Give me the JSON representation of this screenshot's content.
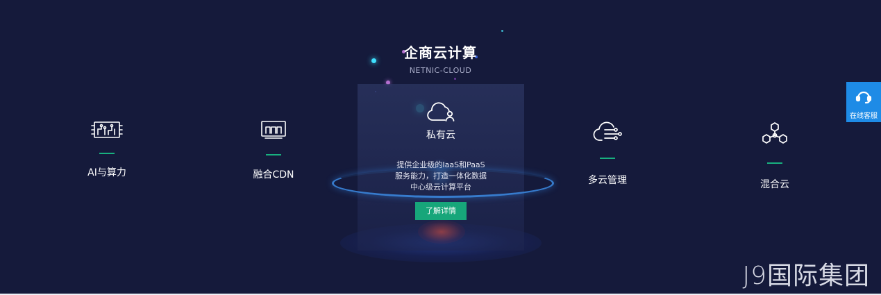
{
  "header": {
    "title": "企商云计算",
    "subtitle": "NETNIC-CLOUD"
  },
  "products": [
    {
      "label": "AI与算力",
      "icon": "chip-icon"
    },
    {
      "label": "融合CDN",
      "icon": "monitor-chart-icon"
    },
    {
      "label": "多云管理",
      "icon": "cloud-network-icon"
    },
    {
      "label": "混合云",
      "icon": "nodes-icon"
    }
  ],
  "active_product": {
    "label": "私有云",
    "icon": "cloud-user-icon",
    "description": [
      "提供企业级的IaaS和PaaS",
      "服务能力，打造一体化数据",
      "中心级云计算平台"
    ],
    "button_label": "了解详情"
  },
  "service": {
    "label": "在线客服",
    "icon": "headset-icon"
  },
  "watermark": "J9国际集团",
  "colors": {
    "background": "#151a3b",
    "accent_green": "#18b07f",
    "button_green": "#17a67a",
    "service_blue": "#1e8be6"
  }
}
